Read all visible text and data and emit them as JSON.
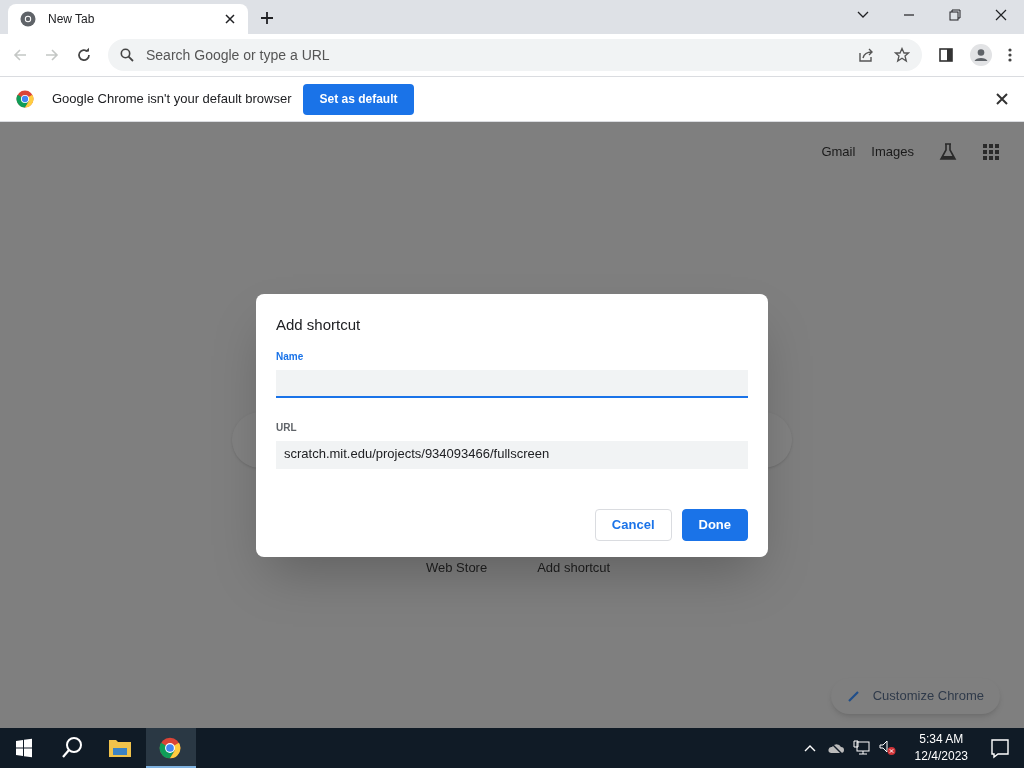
{
  "tabs": [
    {
      "title": "New Tab",
      "selected": true
    }
  ],
  "address_bar": {
    "placeholder": "Search Google or type a URL"
  },
  "infobar": {
    "message": "Google Chrome isn't your default browser",
    "button": "Set as default"
  },
  "page": {
    "links": [
      "Gmail",
      "Images"
    ],
    "shortcuts": [
      "Web Store",
      "Add shortcut"
    ],
    "customize": "Customize Chrome"
  },
  "dialog": {
    "title": "Add shortcut",
    "fields": [
      {
        "label": "Name",
        "focused": true
      },
      {
        "label": "URL",
        "value": "scratch.mit.edu/projects/934093466/fullscreen",
        "focused": false
      }
    ],
    "buttons": [
      {
        "label": "Cancel",
        "kind": "secondary"
      },
      {
        "label": "Done",
        "kind": "primary"
      }
    ]
  },
  "taskbar": {
    "apps": [
      {
        "selected": false,
        "kind": "explorer"
      },
      {
        "selected": true,
        "kind": "chrome"
      }
    ],
    "time": "5:34 AM",
    "date": "12/4/2023"
  }
}
